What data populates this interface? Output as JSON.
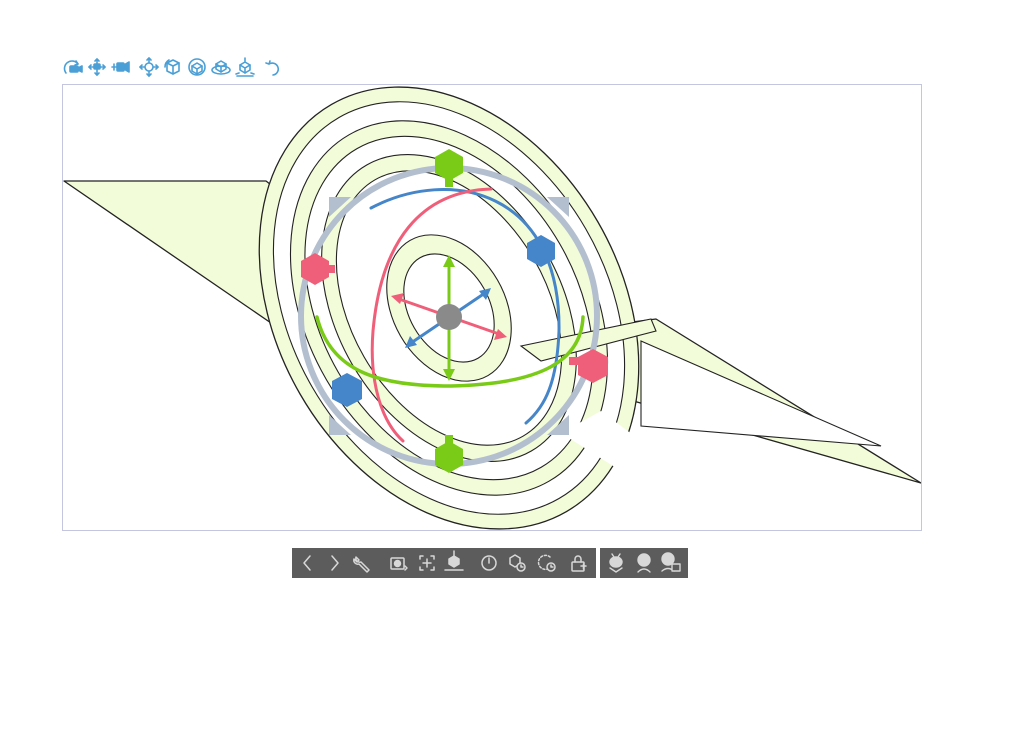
{
  "colors": {
    "toolbar_icon": "#4a9fd6",
    "model_fill": "#f3fcd9",
    "model_stroke": "#232323",
    "gizmo_ring": "#b3bfcf",
    "axis_x": "#ef5f79",
    "axis_y": "#7acb17",
    "axis_z": "#4585c9",
    "gizmo_center": "#8a8a8a",
    "bottom_toolbar_bg": "#5c5c5c",
    "bottom_toolbar_icon": "#d8d8d8",
    "viewport_border": "#c3c6de"
  },
  "top_toolbar": {
    "tools": [
      {
        "name": "camera-rotate-icon"
      },
      {
        "name": "camera-pan-icon"
      },
      {
        "name": "camera-dolly-icon"
      },
      {
        "name": "object-move-icon"
      },
      {
        "name": "object-rotate-icon"
      },
      {
        "name": "object-rotate-view-icon"
      },
      {
        "name": "object-scale-icon"
      },
      {
        "name": "object-move-floor-icon"
      },
      {
        "name": "reset-rotation-icon"
      }
    ]
  },
  "viewport": {
    "gizmo_mode": "rotate",
    "selected_object": "ring-model"
  },
  "bottom_toolbar": {
    "groups": [
      {
        "tools": [
          {
            "name": "previous-icon"
          },
          {
            "name": "next-icon"
          },
          {
            "name": "settings-wrench-icon"
          },
          {
            "name": "camera-angle-icon"
          },
          {
            "name": "fit-to-view-icon"
          },
          {
            "name": "land-on-floor-icon"
          },
          {
            "name": "reset-rotation-icon"
          },
          {
            "name": "initial-position-icon"
          },
          {
            "name": "rotate-reset-icon"
          },
          {
            "name": "lock-icon"
          }
        ]
      },
      {
        "tools": [
          {
            "name": "light-source-icon"
          },
          {
            "name": "head-light-icon"
          },
          {
            "name": "material-light-icon"
          }
        ]
      }
    ]
  }
}
